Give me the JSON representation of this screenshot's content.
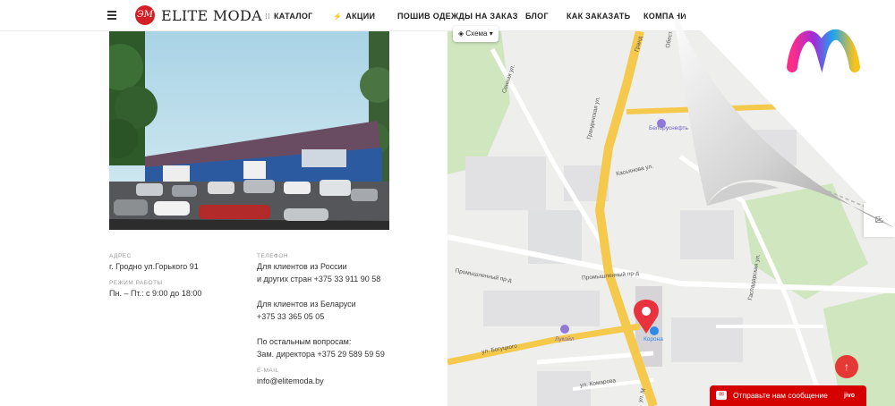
{
  "header": {
    "logo_text": "ELITE MODA",
    "logo_monogram": "ЭМ",
    "nav": [
      {
        "label": "КАТАЛОГ",
        "icon": "grid-icon"
      },
      {
        "label": "АКЦИИ",
        "icon": "lightning-icon"
      },
      {
        "label": "ПОШИВ ОДЕЖДЫ НА ЗАКАЗ"
      },
      {
        "label": "БЛОГ"
      },
      {
        "label": "КАК ЗАКАЗАТЬ"
      },
      {
        "label": "КОМПАНИ"
      }
    ]
  },
  "contacts": {
    "address_label": "АДРЕС",
    "address": "г. Гродно ул.Горького 91",
    "hours_label": "РЕЖИМ РАБОТЫ",
    "hours": "Пн. – Пт.: с 9:00 до 18:00",
    "phone_label": "ТЕЛЕФОН",
    "russia_line1": "Для клиентов из России",
    "russia_line2": "и других стран +375 33 911 90 58",
    "belarus_line1": "Для клиентов из Беларуси",
    "belarus_line2": "+375 33 365 05 05",
    "other_line1": "По остальным вопросам:",
    "other_line2": "Зам. директора +375 29 589 59 59",
    "email_label": "E-MAIL",
    "email": "info@elitemoda.by"
  },
  "map": {
    "scheme_button": "Схема",
    "streets": {
      "grandichskaya": "Грандичская ул.",
      "sennaya": "Сенная ул.",
      "kasyanova": "Касьянова ул.",
      "promyshlennyy": "Промышленный пр-д",
      "bogushevicha": "ул. Богуцкого",
      "komarova": "ул. Комарова",
      "gaspadarskaya": "Гаспадарская ул.",
      "grand2": "Гранд",
      "gorkogo": "ул. М",
      "obesta": "Обеста"
    },
    "pois": {
      "belorusneft": "Белоруснефть",
      "lukoil": "Лукойл",
      "korona": "Корона"
    }
  },
  "widgets": {
    "chat_text": "Отправьте нам сообщение",
    "chat_brand": "jivo",
    "up_arrow": "↑",
    "mail_icon": "✉"
  },
  "colors": {
    "brand_red": "#d32027",
    "chat_red": "#d50000",
    "up_button": "#e53935",
    "map_road": "#f5c94b",
    "map_green": "#c8e6b4"
  }
}
